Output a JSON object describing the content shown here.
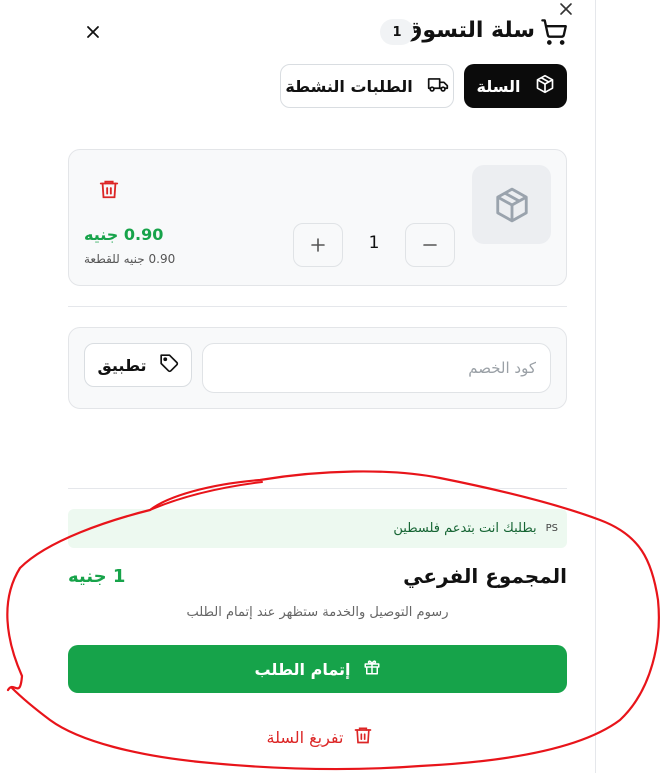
{
  "header": {
    "title": "سلة التسوق",
    "item_count": "1"
  },
  "tabs": [
    {
      "label": "السلة",
      "active": true
    },
    {
      "label": "الطلبات النشطة",
      "active": false
    }
  ],
  "cart_item": {
    "total_price": "0.90 جنيه",
    "unit_price": "0.90 جنيه للقطعة",
    "quantity": "1"
  },
  "coupon": {
    "placeholder": "كود الخصم",
    "apply_label": "تطبيق"
  },
  "notice": {
    "badge": "PS",
    "text": "بطلبك انت بتدعم فلسطين"
  },
  "summary": {
    "subtotal_label": "المجموع الفرعي",
    "subtotal_value": "1 جنيه",
    "fees_note": "رسوم التوصيل والخدمة ستظهر عند إتمام الطلب"
  },
  "actions": {
    "checkout_label": "إتمام الطلب",
    "empty_cart_label": "تفريغ السلة"
  },
  "colors": {
    "accent_green": "#16a34a",
    "danger_red": "#dc2626",
    "tab_active_bg": "#0b0b0b",
    "annotation_red": "#e8141a"
  },
  "icons": {
    "cart": "shopping-cart-icon",
    "close": "close-icon",
    "package": "package-icon",
    "truck": "truck-icon",
    "trash": "trash-icon",
    "tag": "tag-icon",
    "gift": "gift-icon"
  }
}
